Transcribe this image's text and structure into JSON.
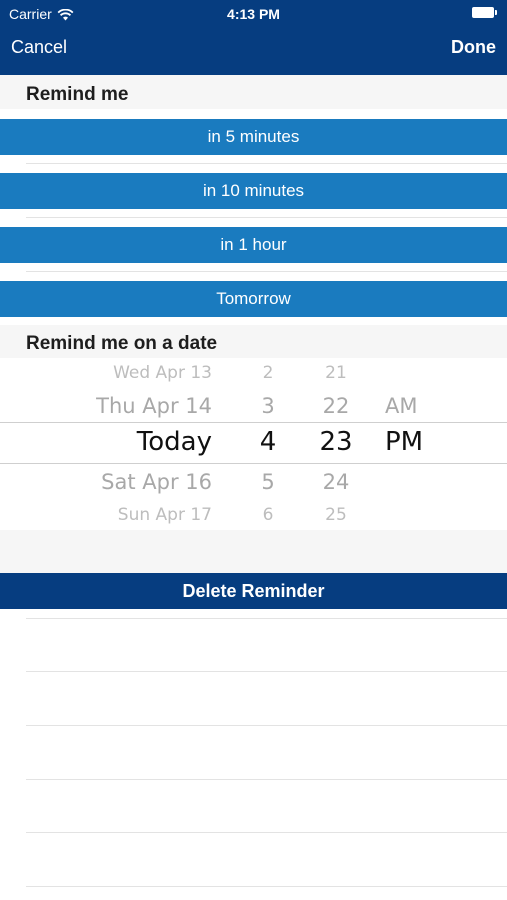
{
  "status_bar": {
    "carrier": "Carrier",
    "time": "4:13 PM"
  },
  "nav": {
    "cancel_label": "Cancel",
    "done_label": "Done",
    "background_color": "#063d80"
  },
  "remind_me": {
    "header": "Remind me",
    "options": [
      "in 5 minutes",
      "in 10 minutes",
      "in 1 hour",
      "Tomorrow"
    ],
    "button_color": "#1a7bbf"
  },
  "remind_on_date": {
    "header": "Remind me on a date",
    "picker": {
      "dates": [
        "Wed Apr 13",
        "Thu Apr 14",
        "Today",
        "Sat Apr 16",
        "Sun Apr 17"
      ],
      "hours": [
        "2",
        "3",
        "4",
        "5",
        "6"
      ],
      "minutes": [
        "21",
        "22",
        "23",
        "24",
        "25"
      ],
      "periods": [
        "AM",
        "PM"
      ],
      "selected": {
        "date": "Today",
        "hour": "4",
        "minute": "23",
        "period": "PM"
      }
    }
  },
  "delete_button": {
    "label": "Delete Reminder"
  }
}
